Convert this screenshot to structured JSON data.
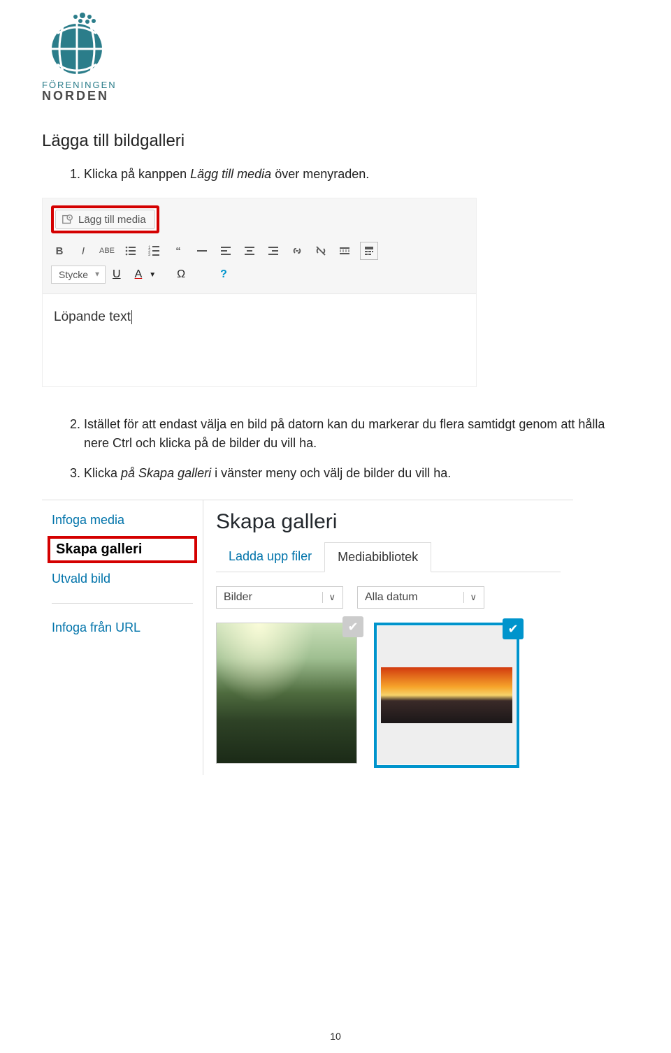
{
  "logo": {
    "line1": "FÖRENINGEN",
    "line2": "NORDEN"
  },
  "heading": "Lägga till bildgalleri",
  "steps": {
    "s1_pre": "Klicka på kanppen ",
    "s1_em": "Lägg till media",
    "s1_post": " över menyraden.",
    "s2": "Istället för att endast välja en bild på datorn kan du markerar du flera samtidgt genom att hålla nere Ctrl och klicka på de bilder du vill ha.",
    "s3_pre": "Klicka ",
    "s3_em": "på Skapa galleri",
    "s3_post": " i vänster meny och välj de bilder du vill ha."
  },
  "editor": {
    "add_media": "Lägg till media",
    "format": "Stycke",
    "body": "Löpande text"
  },
  "modal": {
    "left": {
      "infoga_media": "Infoga media",
      "skapa_galleri": "Skapa galleri",
      "utvald_bild": "Utvald bild",
      "infoga_url": "Infoga från URL"
    },
    "title": "Skapa galleri",
    "tabs": {
      "upload": "Ladda upp filer",
      "library": "Mediabibliotek"
    },
    "filters": {
      "type": "Bilder",
      "date": "Alla datum"
    }
  },
  "page_number": "10"
}
